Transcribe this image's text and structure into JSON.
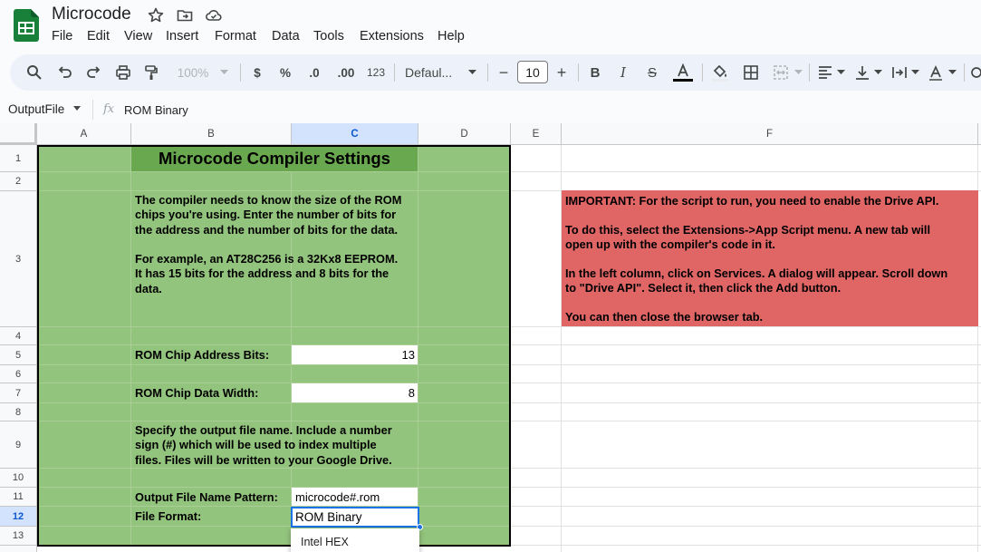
{
  "app": {
    "title": "Microcode",
    "brand_color": "#188038"
  },
  "menu": [
    "File",
    "Edit",
    "View",
    "Insert",
    "Format",
    "Data",
    "Tools",
    "Extensions",
    "Help"
  ],
  "toolbar": {
    "zoom": "100%",
    "currency": "$",
    "percent": "%",
    "dec_decrease": ".0",
    "dec_increase": ".00",
    "number_format": "123",
    "font": "Defaul...",
    "font_size": "10"
  },
  "formula_bar": {
    "name_box": "OutputFile",
    "fx": "fx",
    "content": "ROM Binary"
  },
  "columns": [
    "A",
    "B",
    "C",
    "D",
    "E",
    "F"
  ],
  "rows": [
    "1",
    "2",
    "3",
    "4",
    "5",
    "6",
    "7",
    "8",
    "9",
    "10",
    "11",
    "12",
    "13"
  ],
  "sheet": {
    "title": "Microcode Compiler Settings",
    "intro_lines": [
      "The compiler needs to know the size of the ROM",
      "chips you're using. Enter the number of bits for",
      "the address and the number of bits for the data.",
      "",
      "For example, an AT28C256 is a 32Kx8 EEPROM.",
      "It has 15 bits for the address and 8 bits for the",
      "data."
    ],
    "address_label": "ROM Chip Address Bits:",
    "address_value": "13",
    "width_label": "ROM Chip Data Width:",
    "width_value": "8",
    "output_lines": [
      "Specify the output file name. Include a number",
      "sign (#) which will be used to index multiple",
      "files. Files will be written to your Google Drive."
    ],
    "pattern_label": "Output File Name Pattern:",
    "pattern_value": "microcode#.rom",
    "format_label": "File Format:",
    "format_value": "ROM Binary",
    "dropdown_option": "Intel HEX"
  },
  "notice": {
    "para1": "IMPORTANT: For the script to run, you need to enable the Drive API.",
    "para2a": "To do this, select the Extensions->App Script menu. A new tab will",
    "para2b": "open up with the compiler's code in it.",
    "para3a": "In the left column, click on Services. A dialog will appear. Scroll down",
    "para3b": "to \"Drive API\". Select it, then click the Add button.",
    "para4": "You can then close the browser tab."
  },
  "colors": {
    "green_fill": "#93c47d",
    "title_fill": "#6aa84f",
    "notice_fill": "#e06666",
    "selection": "#1a73e8"
  },
  "icons": [
    "sheets-logo",
    "star-icon",
    "move-folder-icon",
    "cloud-status-icon",
    "search-icon",
    "undo-icon",
    "redo-icon",
    "print-icon",
    "paint-format-icon",
    "bold-icon",
    "italic-icon",
    "strikethrough-icon",
    "text-color-icon",
    "fill-color-icon",
    "borders-icon",
    "merge-icon",
    "align-icon",
    "valign-icon",
    "wrap-icon",
    "rotate-icon"
  ]
}
